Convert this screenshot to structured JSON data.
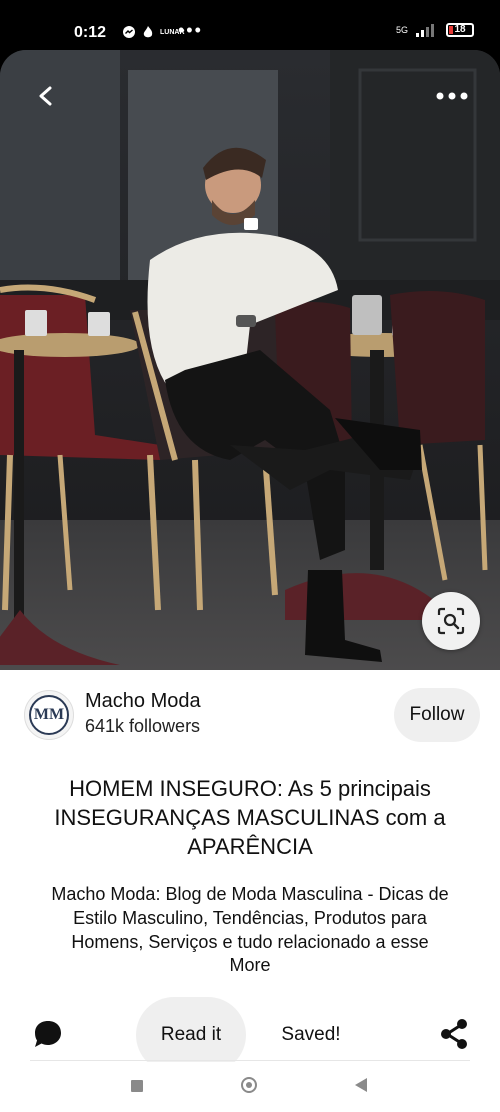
{
  "status_bar": {
    "time": "0:12",
    "lunar_label": "LUNAR",
    "network": "5G",
    "battery": "18"
  },
  "pin": {
    "creator_name": "Macho Moda",
    "followers": "641k followers",
    "avatar_initials": "MM",
    "follow_label": "Follow",
    "title": "HOMEM INSEGURO: As 5 principais INSEGURANÇAS MASCULINAS com a APARÊNCIA",
    "description": "Macho Moda: Blog de Moda Masculina - Dicas de Estilo Masculino, Tendências, Produtos para Homens, Serviços e tudo relacionado a esse",
    "more_label": "More"
  },
  "actions": {
    "read_label": "Read it",
    "saved_label": "Saved!"
  },
  "icons": {
    "back": "back-arrow-icon",
    "more": "more-dots-icon",
    "lens": "visual-search-icon",
    "comment": "comment-icon",
    "share": "share-icon"
  }
}
